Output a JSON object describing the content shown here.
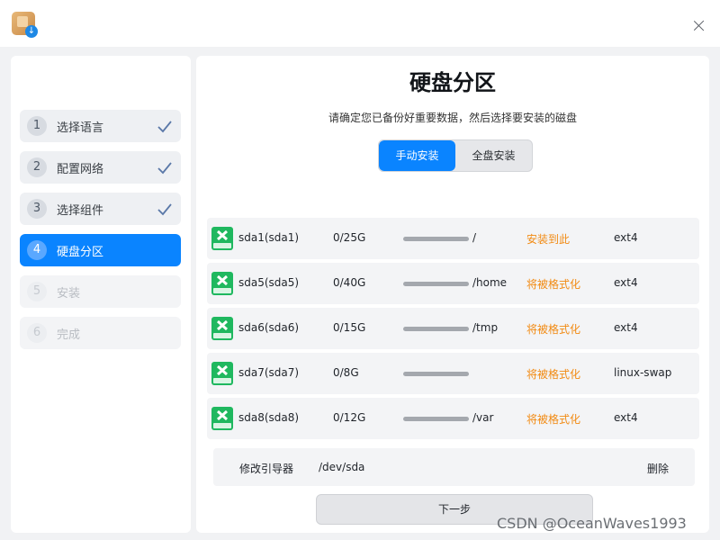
{
  "window": {
    "icon": "installer-app-icon",
    "close_icon": "close-icon"
  },
  "sidebar": {
    "steps": [
      {
        "num": "1",
        "label": "选择语言",
        "state": "done"
      },
      {
        "num": "2",
        "label": "配置网络",
        "state": "done"
      },
      {
        "num": "3",
        "label": "选择组件",
        "state": "done"
      },
      {
        "num": "4",
        "label": "硬盘分区",
        "state": "active"
      },
      {
        "num": "5",
        "label": "安装",
        "state": "disabled"
      },
      {
        "num": "6",
        "label": "完成",
        "state": "disabled"
      }
    ]
  },
  "main": {
    "title": "硬盘分区",
    "subtitle": "请确定您已备份好重要数据，然后选择要安装的磁盘",
    "mode_tabs": [
      {
        "label": "手动安装",
        "selected": true
      },
      {
        "label": "全盘安装",
        "selected": false
      }
    ],
    "partitions": [
      {
        "name": "sda1(sda1)",
        "size": "0/25G",
        "used_fraction": 0,
        "mount": "/",
        "status": "安装到此",
        "fs": "ext4"
      },
      {
        "name": "sda5(sda5)",
        "size": "0/40G",
        "used_fraction": 0,
        "mount": "/home",
        "status": "将被格式化",
        "fs": "ext4"
      },
      {
        "name": "sda6(sda6)",
        "size": "0/15G",
        "used_fraction": 0,
        "mount": "/tmp",
        "status": "将被格式化",
        "fs": "ext4"
      },
      {
        "name": "sda7(sda7)",
        "size": "0/8G",
        "used_fraction": 0,
        "mount": "",
        "status": "将被格式化",
        "fs": "linux-swap"
      },
      {
        "name": "sda8(sda8)",
        "size": "0/12G",
        "used_fraction": 0,
        "mount": "/var",
        "status": "将被格式化",
        "fs": "ext4"
      }
    ],
    "bootloader": {
      "label": "修改引导器",
      "device": "/dev/sda",
      "delete_label": "删除"
    },
    "next_button": "下一步"
  },
  "watermark": "CSDN @OceanWaves1993",
  "colors": {
    "accent": "#0a84ff",
    "status_warning": "#f28a12",
    "disk_icon": "#1fb85f"
  }
}
